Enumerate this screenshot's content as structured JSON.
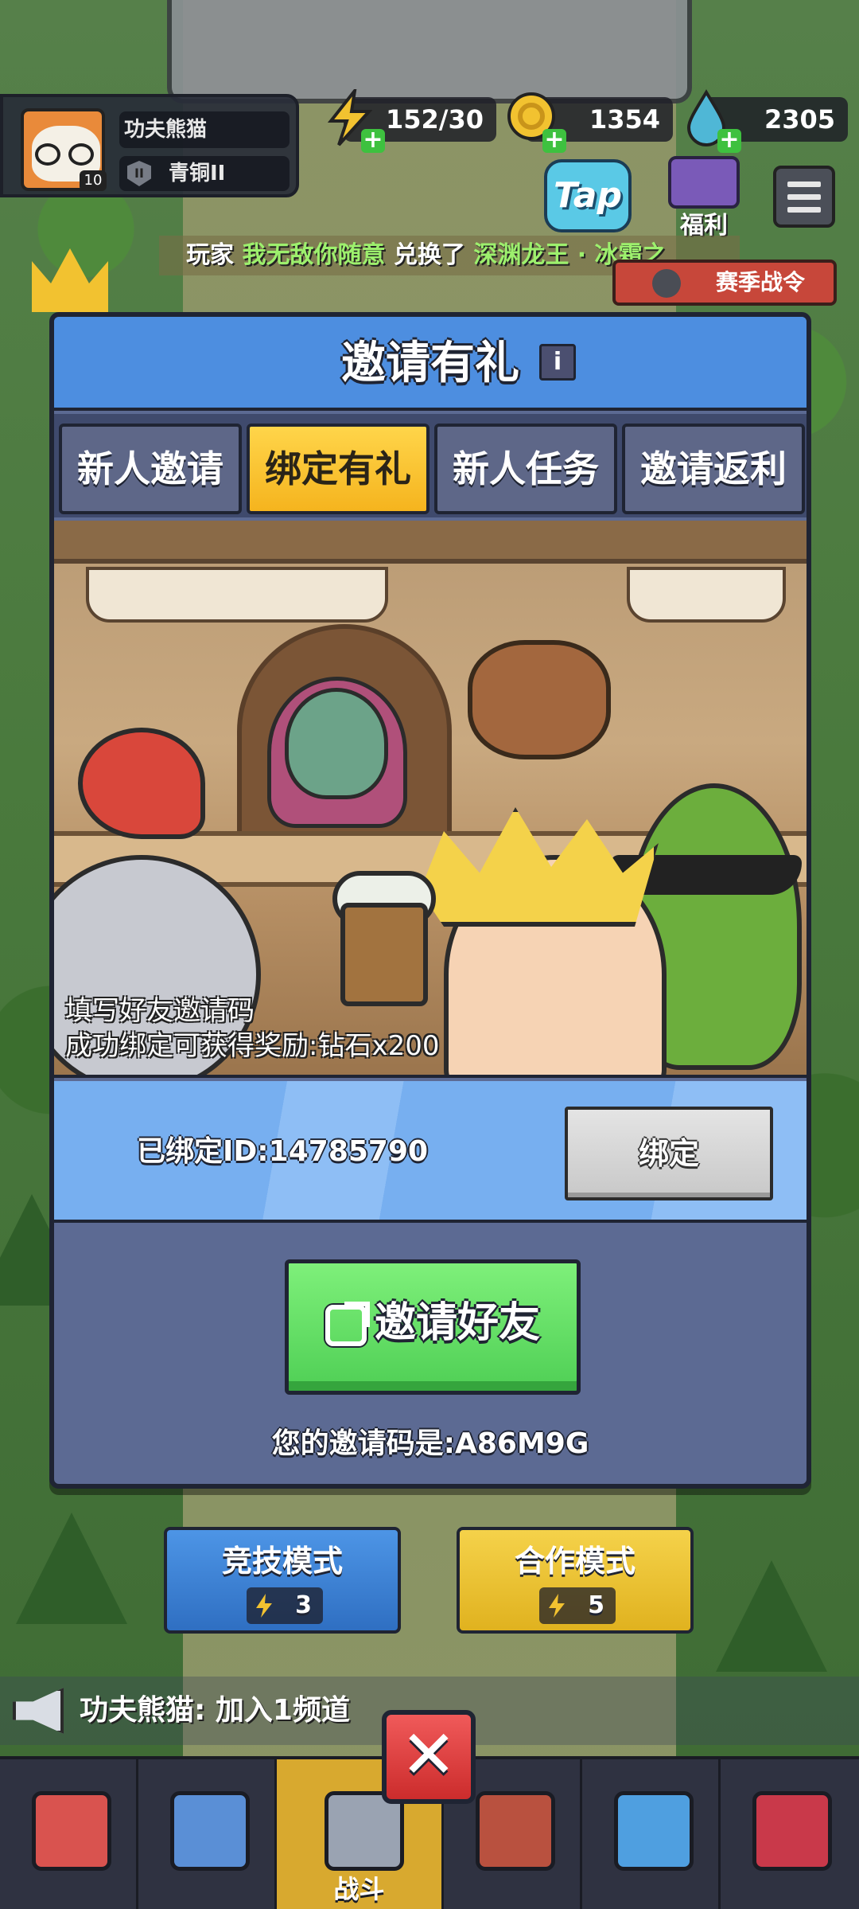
{
  "player": {
    "name": "功夫熊猫",
    "level": "10",
    "rank": "青铜II"
  },
  "resources": {
    "energy": "152/30",
    "gold": "1354",
    "diamond": "2305"
  },
  "hud": {
    "tap_label": "Tap",
    "welfare_label": "福利",
    "season_pass_label": "赛季战令"
  },
  "ticker": {
    "prefix": "玩家",
    "player": "我无敌你随意",
    "action": "兑换了",
    "item": "深渊龙王 · 冰霜之"
  },
  "modal": {
    "title": "邀请有礼",
    "info_icon": "i",
    "tabs": [
      {
        "label": "新人邀请",
        "active": false
      },
      {
        "label": "绑定有礼",
        "active": true
      },
      {
        "label": "新人任务",
        "active": false
      },
      {
        "label": "邀请返利",
        "active": false
      }
    ],
    "caption_line1": "填写好友邀请码",
    "caption_line2": "成功绑定可获得奖励:钻石x200",
    "bound_id": "已绑定ID:14785790",
    "bind_button": "绑定",
    "invite_button": "邀请好友",
    "invite_code": "您的邀请码是:A86M9G"
  },
  "modes": {
    "competitive": {
      "label": "竞技模式",
      "cost": "3"
    },
    "coop": {
      "label": "合作模式",
      "cost": "5"
    }
  },
  "chat": {
    "message": "功夫熊猫: 加入1频道"
  },
  "nav": {
    "battle_label": "战斗"
  },
  "close_icon": "✕",
  "colors": {
    "modal_header": "#4d8ee0",
    "active_tab": "#f5b41e",
    "invite_button": "#4fcf55",
    "close_button": "#cc2c2c"
  }
}
